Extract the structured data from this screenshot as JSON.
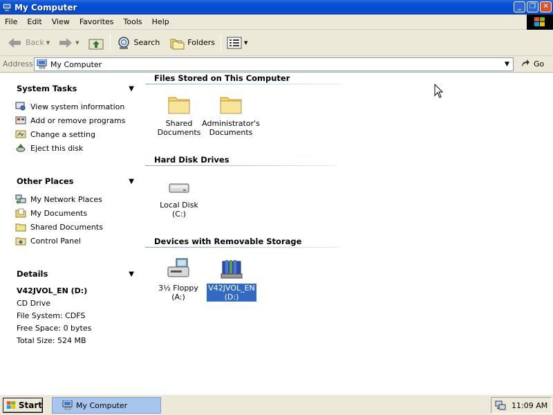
{
  "window": {
    "title": "My Computer"
  },
  "menu": [
    "File",
    "Edit",
    "View",
    "Favorites",
    "Tools",
    "Help"
  ],
  "toolbar": {
    "back_label": "Back",
    "search_label": "Search",
    "folders_label": "Folders"
  },
  "address": {
    "label": "Address",
    "value": "My Computer",
    "go_label": "Go"
  },
  "left_panel": {
    "system_tasks": {
      "title": "System Tasks",
      "items": [
        "View system information",
        "Add or remove programs",
        "Change a setting",
        "Eject this disk"
      ]
    },
    "other_places": {
      "title": "Other Places",
      "items": [
        "My Network Places",
        "My Documents",
        "Shared Documents",
        "Control Panel"
      ]
    },
    "details": {
      "title": "Details",
      "name": "V42JVOL_EN (D:)",
      "type": "CD Drive",
      "file_system": "File System: CDFS",
      "free_space": "Free Space: 0 bytes",
      "total_size": "Total Size: 524 MB"
    }
  },
  "sections": {
    "files_stored": {
      "title": "Files Stored on This Computer",
      "items": [
        {
          "line1": "Shared",
          "line2": "Documents"
        },
        {
          "line1": "Administrator's",
          "line2": "Documents"
        }
      ]
    },
    "hard_disks": {
      "title": "Hard Disk Drives",
      "items": [
        {
          "line1": "Local Disk (C:)"
        }
      ]
    },
    "removable": {
      "title": "Devices with Removable Storage",
      "items": [
        {
          "line1": "3½ Floppy",
          "line2": "(A:)"
        },
        {
          "line1": "V42JVOL_EN",
          "line2": "(D:)"
        }
      ]
    }
  },
  "taskbar": {
    "start_label": "Start",
    "task_label": "My Computer",
    "clock": "11:09 AM"
  },
  "colors": {
    "titlebar": "#0549d1",
    "selection": "#316ac5",
    "chrome": "#ece9d8",
    "taskbar_active": "#a8c5ee"
  }
}
